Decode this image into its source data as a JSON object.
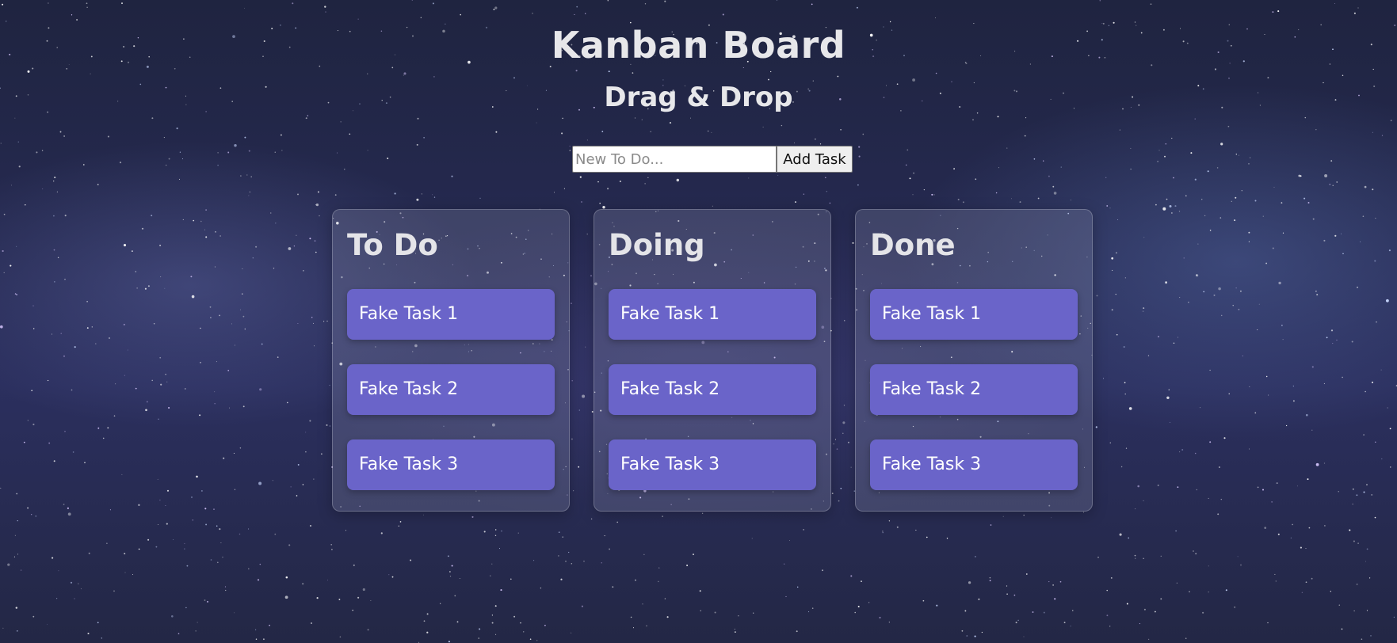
{
  "header": {
    "title": "Kanban Board",
    "subtitle": "Drag & Drop"
  },
  "add_form": {
    "input_placeholder": "New To Do...",
    "input_value": "",
    "button_label": "Add Task"
  },
  "columns": [
    {
      "title": "To Do",
      "tasks": [
        "Fake Task 1",
        "Fake Task 2",
        "Fake Task 3"
      ]
    },
    {
      "title": "Doing",
      "tasks": [
        "Fake Task 1",
        "Fake Task 2",
        "Fake Task 3"
      ]
    },
    {
      "title": "Done",
      "tasks": [
        "Fake Task 1",
        "Fake Task 2",
        "Fake Task 3"
      ]
    }
  ],
  "colors": {
    "task_background": "#6a64c9",
    "heading_text": "#e7e7ea",
    "sky_background": "#262a52"
  }
}
